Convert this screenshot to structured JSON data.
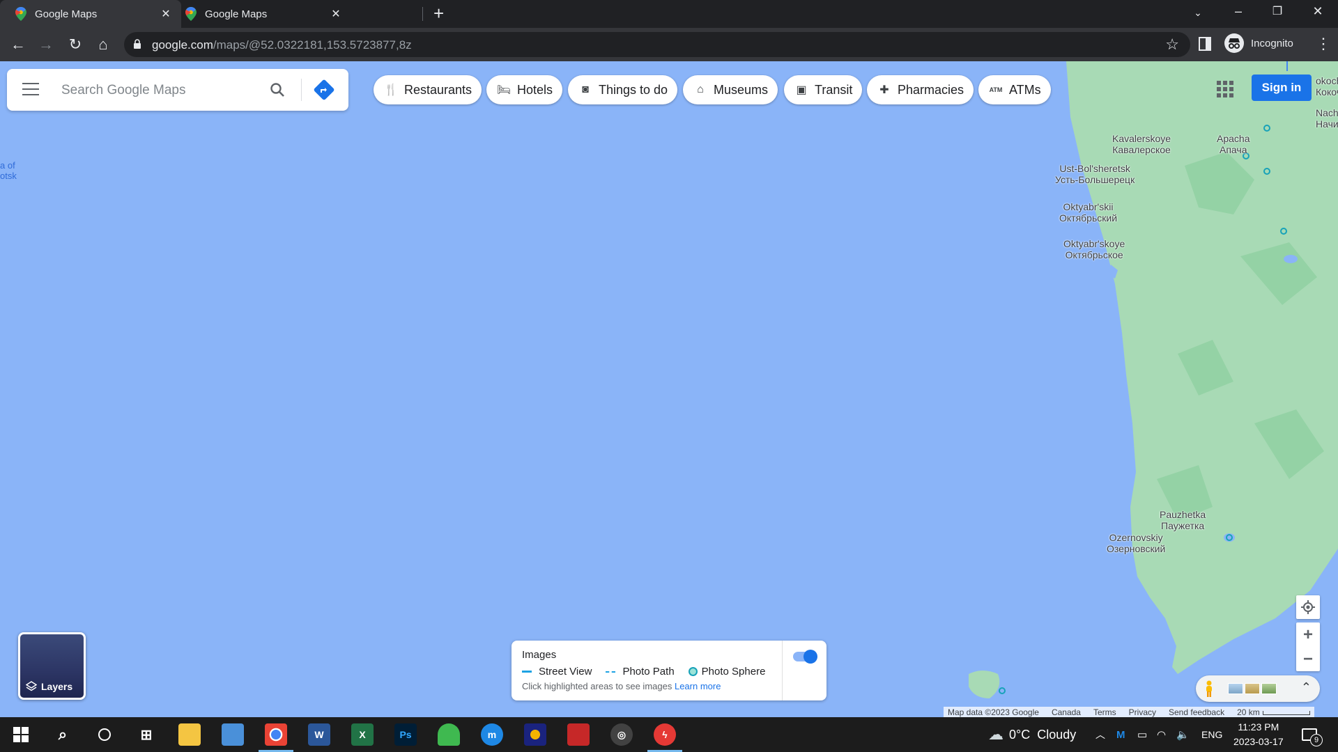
{
  "browser": {
    "tabs": [
      {
        "title": "Google Maps",
        "active": true
      },
      {
        "title": "Google Maps",
        "active": false
      }
    ],
    "new_tab_icon": "plus-icon",
    "url_host": "google.com",
    "url_path": "/maps/@52.0322181,153.5723877,8z",
    "profile_label": "Incognito"
  },
  "maps": {
    "search_placeholder": "Search Google Maps",
    "chips": [
      {
        "label": "Restaurants",
        "icon": "fork-knife-icon"
      },
      {
        "label": "Hotels",
        "icon": "bed-icon"
      },
      {
        "label": "Things to do",
        "icon": "camera-icon"
      },
      {
        "label": "Museums",
        "icon": "museum-icon"
      },
      {
        "label": "Transit",
        "icon": "train-icon"
      },
      {
        "label": "Pharmacies",
        "icon": "pharmacy-icon"
      },
      {
        "label": "ATMs",
        "icon": "atm-icon"
      }
    ],
    "sign_in": "Sign in",
    "layers_label": "Layers",
    "sea_label": "a of\notsk",
    "edge_labels": {
      "top1": "okoch",
      "top2": "Кокоч",
      "top3": "Nach",
      "top4": "Начи"
    },
    "places": [
      {
        "name": "Kavalerskoye\nКавалерское"
      },
      {
        "name": "Apacha\nАпача"
      },
      {
        "name": "Ust-Bol'sheretsk\nУсть-Большерецк"
      },
      {
        "name": "Oktyabr'skii\nОктябрьский"
      },
      {
        "name": "Oktyabr'skoye\nОктябрьское"
      },
      {
        "name": "Pauzhetka\nПаужетка"
      },
      {
        "name": "Ozernovskiy\nОзерновский"
      }
    ],
    "images_panel": {
      "title": "Images",
      "street_view": "Street View",
      "photo_path": "Photo Path",
      "photo_sphere": "Photo Sphere",
      "hint": "Click highlighted areas to see images",
      "learn_more": "Learn more",
      "toggle_on": true
    },
    "footer": {
      "map_data": "Map data ©2023 Google",
      "country": "Canada",
      "terms": "Terms",
      "privacy": "Privacy",
      "feedback": "Send feedback",
      "scale": "20 km"
    }
  },
  "taskbar": {
    "weather": "0°C  Cloudy",
    "language": "ENG",
    "time": "11:23 PM",
    "date": "2023-03-17",
    "notifications": "9"
  },
  "colors": {
    "water": "#8ab4f8",
    "land": "#a8dab5",
    "accent": "#1a73e8"
  }
}
